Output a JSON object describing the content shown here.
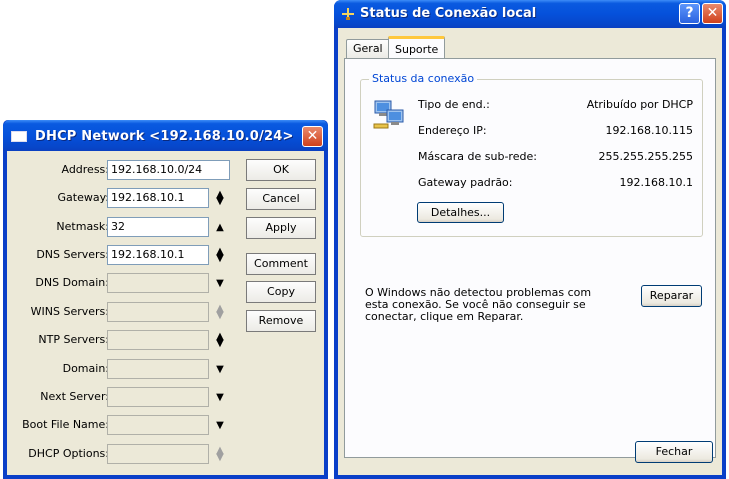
{
  "status_window": {
    "title": "Status de Conexão local",
    "tabs": [
      {
        "label": "Geral"
      },
      {
        "label": "Suporte"
      }
    ],
    "group_title": "Status da conexão",
    "rows": [
      {
        "label": "Tipo de end.:",
        "value": "Atribuído por DHCP"
      },
      {
        "label": "Endereço IP:",
        "value": "192.168.10.115"
      },
      {
        "label": "Máscara de sub-rede:",
        "value": "255.255.255.255"
      },
      {
        "label": "Gateway padrão:",
        "value": "192.168.10.1"
      }
    ],
    "details_label": "Detalhes...",
    "message": "O Windows não detectou problemas com esta conexão. Se você não conseguir se conectar, clique em Reparar.",
    "repair_label": "Reparar",
    "close_label": "Fechar"
  },
  "dhcp_window": {
    "title": "DHCP Network <192.168.10.0/24>",
    "fields": [
      {
        "label": "Address:",
        "value": "192.168.10.0/24"
      },
      {
        "label": "Gateway:",
        "value": "192.168.10.1"
      },
      {
        "label": "Netmask:",
        "value": "32"
      },
      {
        "label": "DNS Servers:",
        "value": "192.168.10.1"
      },
      {
        "label": "DNS Domain:",
        "value": ""
      },
      {
        "label": "WINS Servers:",
        "value": ""
      },
      {
        "label": "NTP Servers:",
        "value": ""
      },
      {
        "label": "Domain:",
        "value": ""
      },
      {
        "label": "Next Server:",
        "value": ""
      },
      {
        "label": "Boot File Name:",
        "value": ""
      },
      {
        "label": "DHCP Options:",
        "value": ""
      }
    ],
    "buttons": {
      "ok": "OK",
      "cancel": "Cancel",
      "apply": "Apply",
      "comment": "Comment",
      "copy": "Copy",
      "remove": "Remove"
    }
  }
}
